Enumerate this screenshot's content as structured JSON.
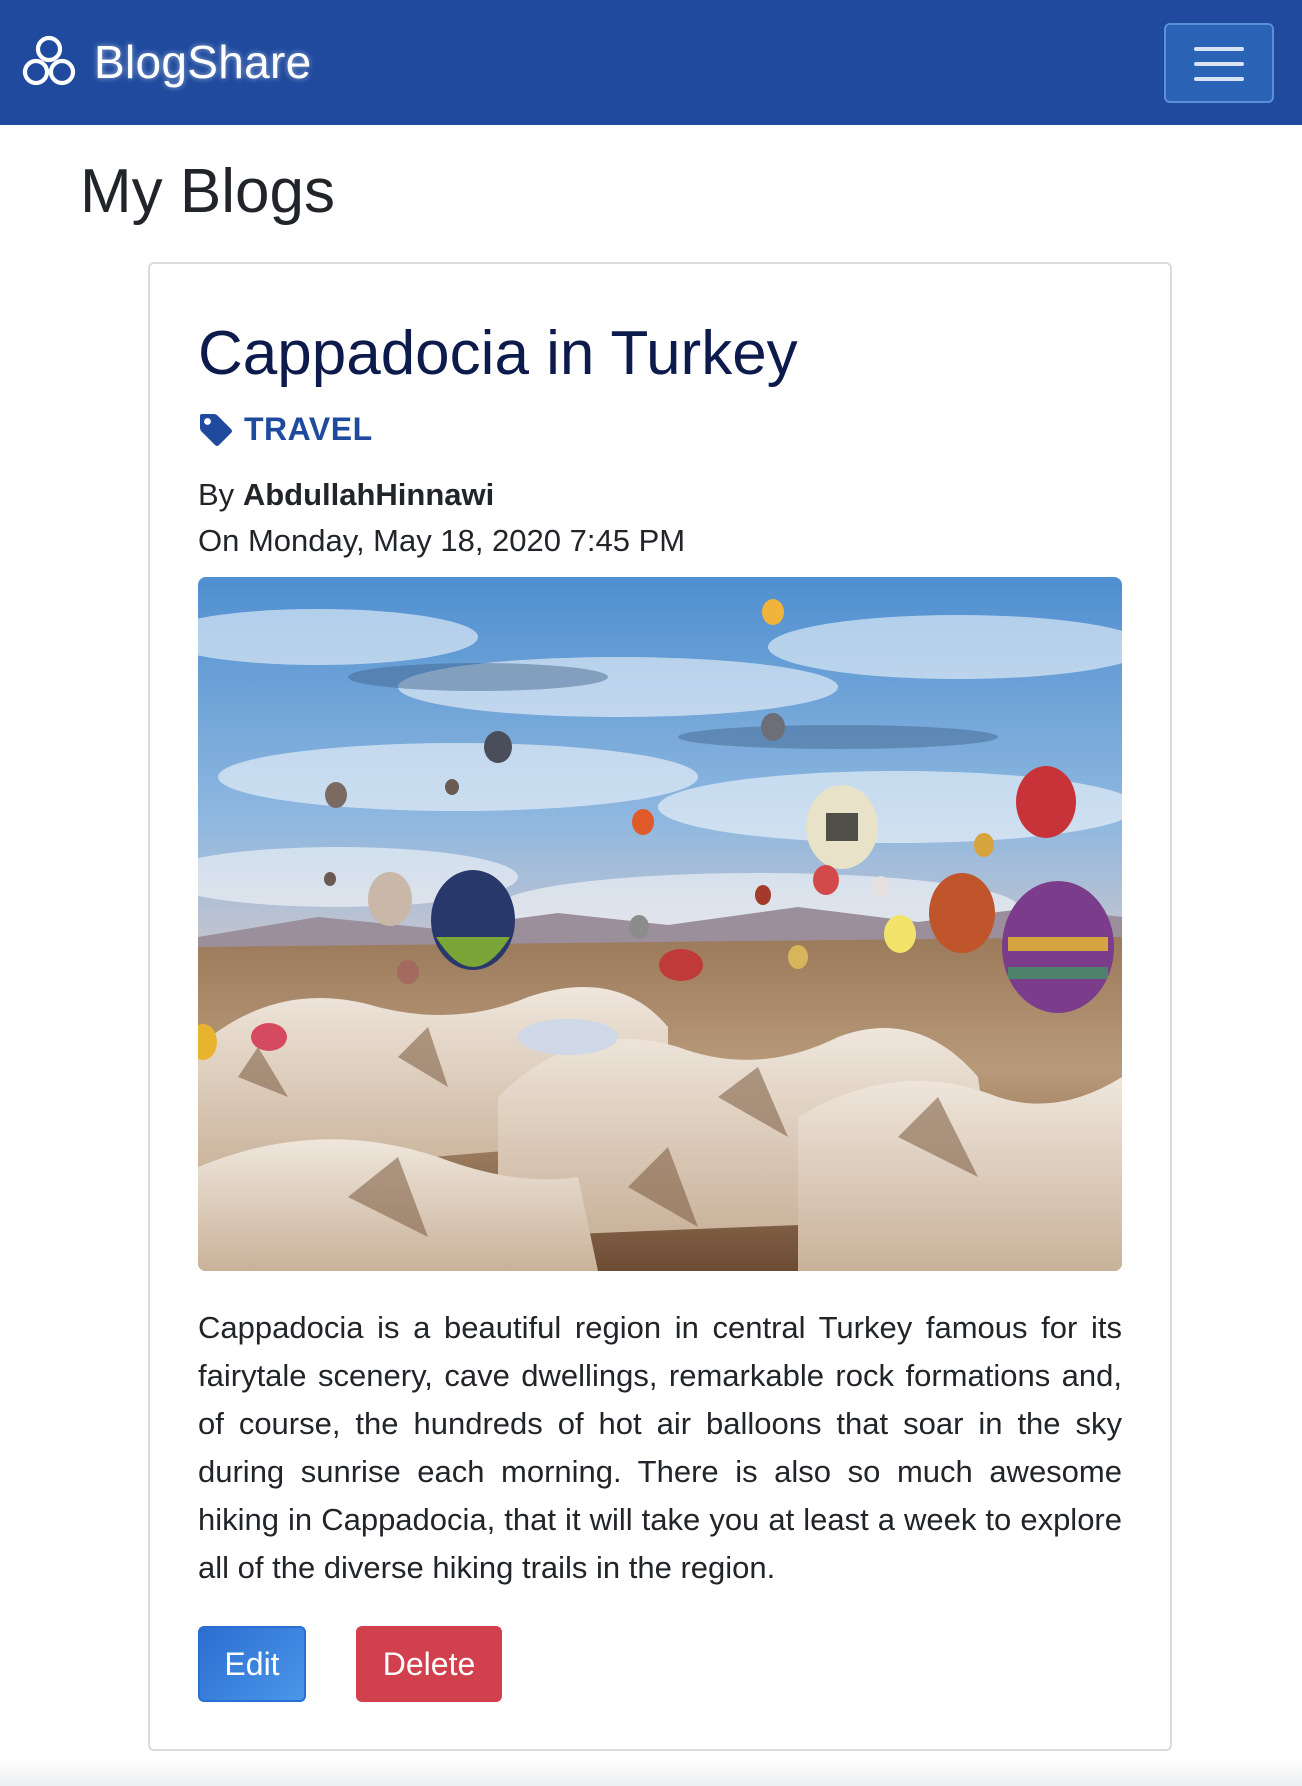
{
  "navbar": {
    "brand": "BlogShare",
    "brand_icon": "bubbles-logo-icon",
    "menu_icon": "hamburger-menu-icon",
    "color": "#1f4a9e"
  },
  "page": {
    "title": "My Blogs"
  },
  "post": {
    "title": "Cappadocia in Turkey",
    "category": "TRAVEL",
    "category_icon": "tag-icon",
    "by_prefix": "By",
    "author": "AbdullahHinnawi",
    "date": "On Monday, May 18, 2020 7:45 PM",
    "image_alt": "Hot air balloons over Cappadocia",
    "body": "Cappadocia is a beautiful region in central Turkey famous for its fairytale scenery, cave dwellings, remarkable rock formations and, of course, the hundreds of hot air balloons that soar in the sky during sunrise each morning. There is also so much awesome hiking in Cappadocia, that it will take you at least a week to explore all of the diverse hiking trails in the region.",
    "actions": {
      "edit": "Edit",
      "delete": "Delete"
    }
  },
  "colors": {
    "primary": "#2b6ed0",
    "danger": "#d1404d",
    "title": "#0d1b4c",
    "tag": "#1f4a9e"
  }
}
